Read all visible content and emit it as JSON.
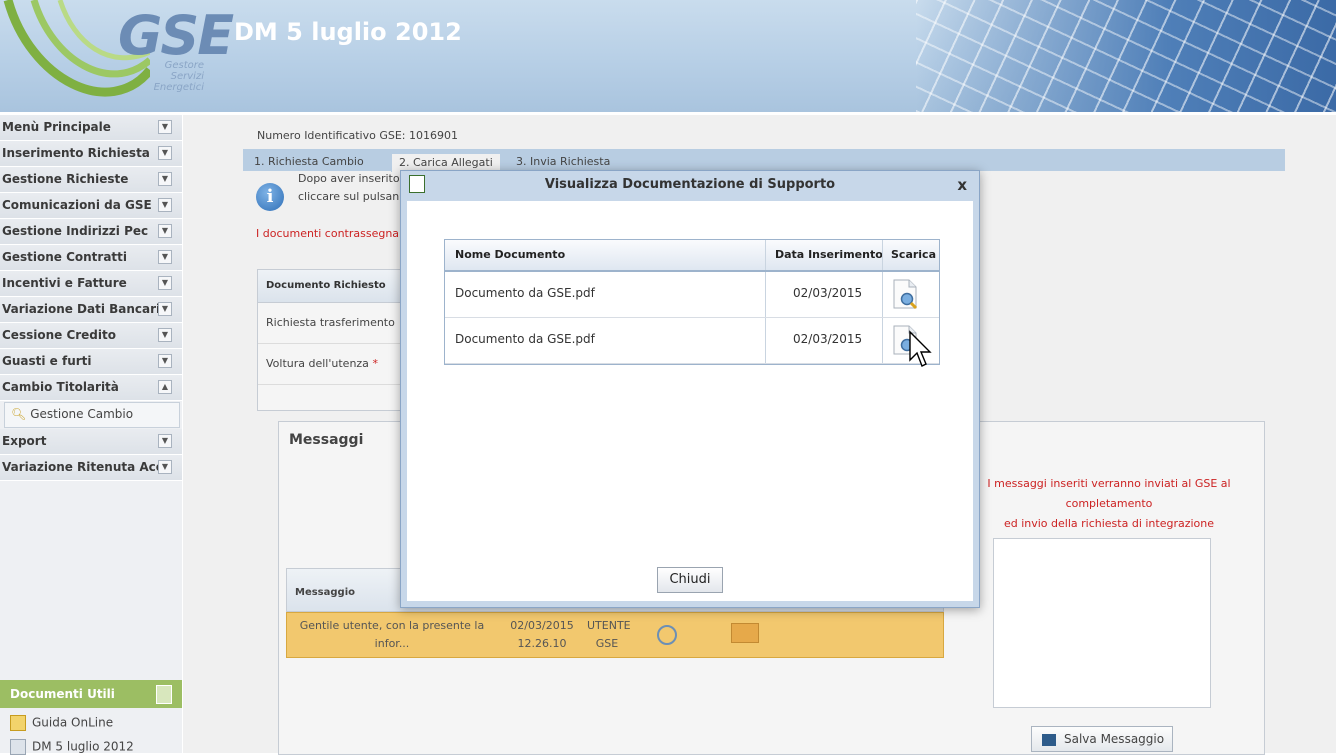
{
  "header": {
    "logo_text": "GSE",
    "logo_sub": [
      "Gestore",
      "Servizi",
      "Energetici"
    ],
    "title": "DM 5 luglio 2012"
  },
  "sidebar": {
    "items": [
      {
        "label": "Menù Principale",
        "state": "collapsed"
      },
      {
        "label": "Inserimento Richiesta",
        "state": "collapsed"
      },
      {
        "label": "Gestione Richieste",
        "state": "collapsed"
      },
      {
        "label": "Comunicazioni da GSE",
        "state": "collapsed"
      },
      {
        "label": "Gestione Indirizzi Pec",
        "state": "collapsed"
      },
      {
        "label": "Gestione Contratti",
        "state": "collapsed"
      },
      {
        "label": "Incentivi e Fatture",
        "state": "collapsed"
      },
      {
        "label": "Variazione Dati Bancari",
        "state": "collapsed"
      },
      {
        "label": "Cessione Credito",
        "state": "collapsed"
      },
      {
        "label": "Guasti e furti",
        "state": "collapsed"
      },
      {
        "label": "Cambio Titolarità",
        "state": "expanded"
      }
    ],
    "sub_item": "Gestione Cambio",
    "items_after": [
      {
        "label": "Export",
        "state": "collapsed"
      },
      {
        "label": "Variazione Ritenuta Acc.",
        "state": "collapsed"
      }
    ],
    "docs": {
      "title": "Documenti Utili",
      "items": [
        "Guida OnLine",
        "DM 5 luglio 2012"
      ]
    }
  },
  "main": {
    "id_line": "Numero Identificativo GSE: 1016901",
    "tabs": [
      "1. Richiesta Cambio",
      "2. Carica Allegati",
      "3. Invia Richiesta"
    ],
    "active_tab": 1,
    "info_text_1": "Dopo aver inserito",
    "info_text_2": "cliccare sul pulsan",
    "red_line": "I documenti contrassegna",
    "doc_table": {
      "header": "Documento Richiesto",
      "rows": [
        "Richiesta trasferimento",
        "Voltura dell'utenza"
      ],
      "required_mark": "*"
    },
    "messages": {
      "title": "Messaggi",
      "note_1": "I messaggi inseriti verranno inviati al GSE al",
      "note_2": "completamento",
      "note_3": "ed invio della richiesta di integrazione",
      "grid_header": "Messaggio",
      "row": {
        "text_1": "Gentile utente, con la presente la",
        "text_2": "infor...",
        "date": "02/03/2015",
        "time": "12.26.10",
        "sender_1": "UTENTE",
        "sender_2": "GSE"
      },
      "save_button": "Salva Messaggio"
    }
  },
  "dialog": {
    "title": "Visualizza Documentazione di Supporto",
    "close": "x",
    "columns": [
      "Nome Documento",
      "Data Inserimento",
      "Scarica"
    ],
    "rows": [
      {
        "name": "Documento da GSE.pdf",
        "date": "02/03/2015"
      },
      {
        "name": "Documento da GSE.pdf",
        "date": "02/03/2015"
      }
    ],
    "close_button": "Chiudi"
  }
}
